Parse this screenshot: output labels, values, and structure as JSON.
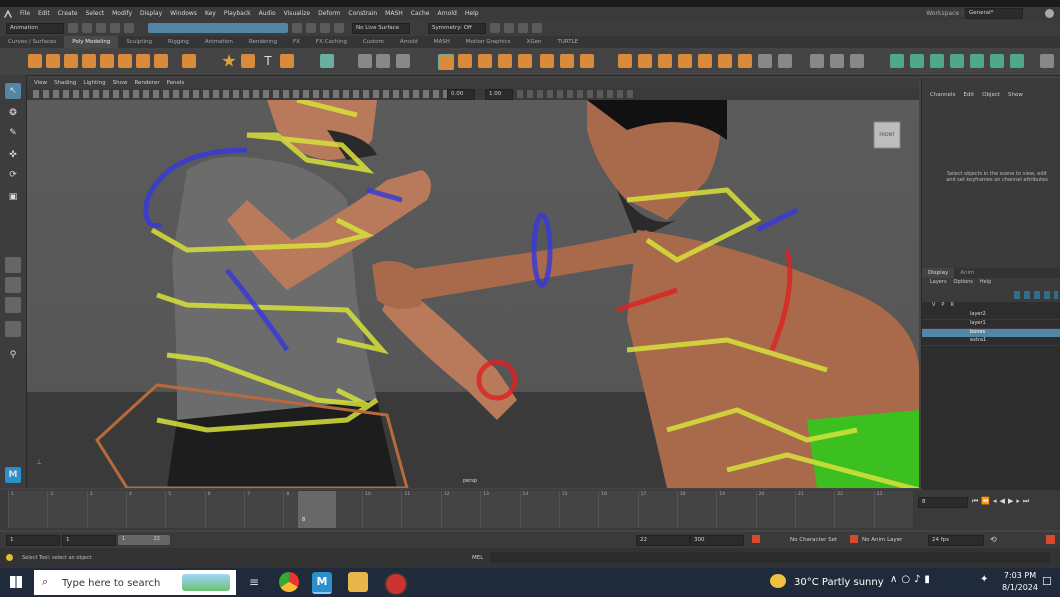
{
  "menubar": {
    "items": [
      "File",
      "Edit",
      "Create",
      "Select",
      "Modify",
      "Display",
      "Windows",
      "Key",
      "Playback",
      "Audio",
      "Visualize",
      "Deform",
      "Constrain",
      "MASH",
      "Cache",
      "Arnold",
      "Help"
    ],
    "workspace_label": "Workspace :",
    "workspace_value": "General*"
  },
  "statusline": {
    "menuset": "Animation",
    "live_surface": "No Live Surface",
    "symmetry": "Symmetry: Off"
  },
  "shelf_tabs": [
    "Curves / Surfaces",
    "Poly Modeling",
    "Sculpting",
    "Rigging",
    "Animation",
    "Rendering",
    "FX",
    "FX Caching",
    "Custom",
    "Arnold",
    "MASH",
    "Motion Graphics",
    "XGen",
    "TURTLE"
  ],
  "shelf_active_index": 1,
  "viewport": {
    "menu": [
      "View",
      "Shading",
      "Lighting",
      "Show",
      "Renderer",
      "Panels"
    ],
    "value_a": "0.00",
    "value_b": "1.00",
    "camera_label": "persp",
    "viewcube_label": "FRONT"
  },
  "channelbox": {
    "menu": [
      "Channels",
      "Edit",
      "Object",
      "Show"
    ],
    "hint": "Select objects in the scene to view, edit and set keyframes on channel attributes"
  },
  "layers": {
    "tabs": [
      "Display",
      "Anim"
    ],
    "menu": [
      "Layers",
      "Options",
      "Help"
    ],
    "header": [
      "V",
      "P",
      "R"
    ],
    "items": [
      {
        "name": "layer2",
        "selected": false
      },
      {
        "name": "layer1",
        "selected": false
      },
      {
        "name": "bones",
        "selected": true
      },
      {
        "name": "extra1",
        "selected": false
      }
    ]
  },
  "timeline": {
    "ticks": [
      "1",
      "2",
      "3",
      "4",
      "5",
      "6",
      "7",
      "8",
      "9",
      "10",
      "11",
      "12",
      "13",
      "14",
      "15",
      "16",
      "17",
      "18",
      "19",
      "20",
      "21",
      "22",
      "23"
    ],
    "current_frame": "8",
    "frame_field": "8"
  },
  "range": {
    "start": "1",
    "start2": "1",
    "range_start": "1",
    "range_end": "22",
    "end": "22",
    "end2": "300",
    "character_set": "No Character Set",
    "anim_layer": "No Anim Layer",
    "fps": "24 fps"
  },
  "helpline": {
    "text": "Select Tool: select an object",
    "mel_label": "MEL"
  },
  "taskbar": {
    "search_placeholder": "Type here to search",
    "weather": "30°C  Partly sunny",
    "time": "7:03 PM",
    "date": "8/1/2024"
  },
  "colors": {
    "accent_blue": "#5285a6",
    "selection_yellow": "#d8e23a",
    "control_blue": "#3a3ad8",
    "control_red": "#e02020",
    "control_orange": "#b86a3c"
  }
}
